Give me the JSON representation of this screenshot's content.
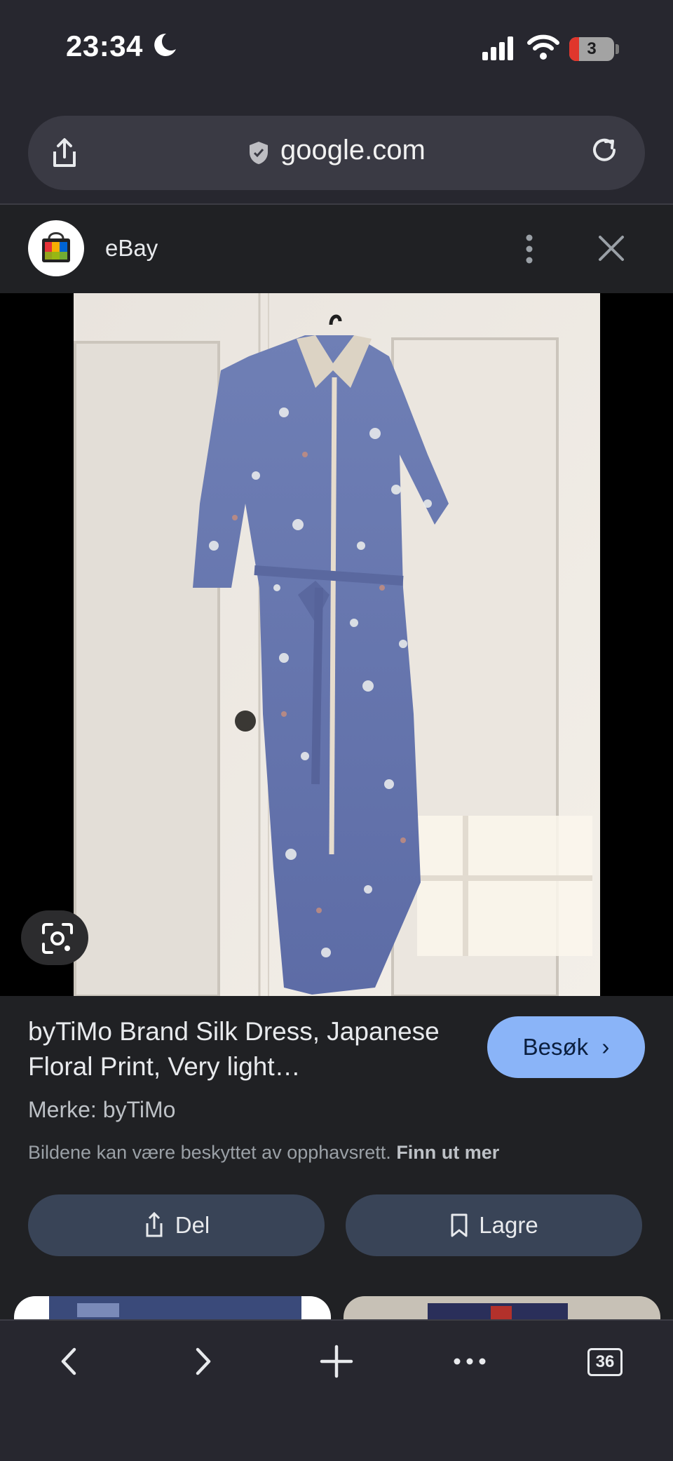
{
  "status_bar": {
    "time": "23:34",
    "battery_level": "3"
  },
  "url_bar": {
    "url": "google.com"
  },
  "site_header": {
    "site_name": "eBay"
  },
  "result": {
    "title": "byTiMo Brand Silk Dress, Japanese Floral Print, Very light…",
    "visit_label": "Besøk",
    "brand_line": "Merke: byTiMo",
    "copyright_notice": "Bildene kan være beskyttet av opphavsrett.",
    "learn_more": "Finn ut mer",
    "share_label": "Del",
    "save_label": "Lagre"
  },
  "bottom_nav": {
    "tab_count": "36"
  },
  "icons": {
    "moon": "moon-icon",
    "signal": "cellular-signal-icon",
    "wifi": "wifi-icon",
    "share": "share-icon",
    "shield": "shield-icon",
    "reload": "reload-icon",
    "more": "more-vertical-icon",
    "close": "close-icon",
    "lens": "google-lens-icon",
    "bookmark": "bookmark-icon",
    "back": "back-icon",
    "forward": "forward-icon",
    "new_tab": "plus-icon",
    "menu": "more-horizontal-icon",
    "tabs": "tab-switcher-icon"
  },
  "colors": {
    "background": "#202124",
    "visit_button": "#8ab4f8",
    "pill_buttons": "#394457",
    "battery_low": "#e0362c"
  }
}
